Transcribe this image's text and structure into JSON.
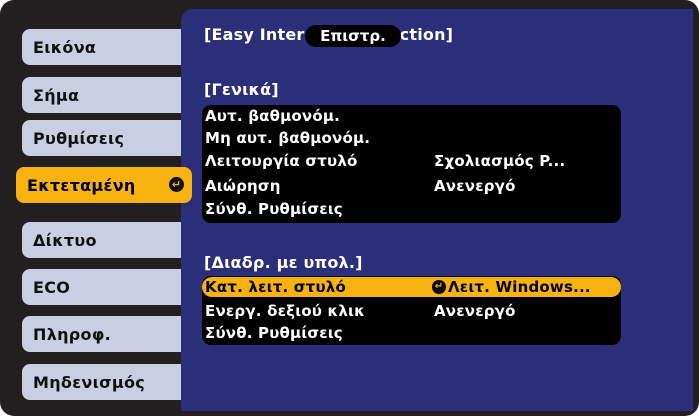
{
  "sidebar": {
    "items": [
      {
        "label": "Εικόνα"
      },
      {
        "label": "Σήμα"
      },
      {
        "label": "Ρυθμίσεις"
      },
      {
        "label": "Εκτεταμένη",
        "active": true
      },
      {
        "label": "Δίκτυο"
      },
      {
        "label": "ECO"
      },
      {
        "label": "Πληροφ."
      },
      {
        "label": "Μηδενισμός"
      }
    ]
  },
  "panel": {
    "title": "[Easy Interactive Function]",
    "back_label": "Επιστρ.",
    "general": {
      "heading": "[Γενικά]",
      "rows": [
        {
          "label": "Αυτ. βαθμονόμ.",
          "value": ""
        },
        {
          "label": "Μη αυτ. βαθμονόμ.",
          "value": ""
        },
        {
          "label": "Λειτουργία στυλό",
          "value": "Σχολιασμός P..."
        },
        {
          "label": "Αιώρηση",
          "value": "Ανενεργό"
        },
        {
          "label": "Σύνθ. Ρυθμίσεις",
          "value": ""
        }
      ]
    },
    "pc_interaction": {
      "heading": "[Διαδρ. με υπολ.]",
      "rows": [
        {
          "label": "Κατ. λειτ. στυλό",
          "value": "Λειτ. Windows...",
          "selected": true
        },
        {
          "label": "Ενεργ. δεξιού κλικ",
          "value": "Ανενεργό"
        },
        {
          "label": "Σύνθ. Ρυθμίσεις",
          "value": ""
        }
      ]
    }
  },
  "colors": {
    "background": "#231f20",
    "panel": "#2b2e78",
    "menu_item": "#c9cfe0",
    "accent": "#f6b20f"
  },
  "icons": {
    "enter": "enter-icon"
  }
}
